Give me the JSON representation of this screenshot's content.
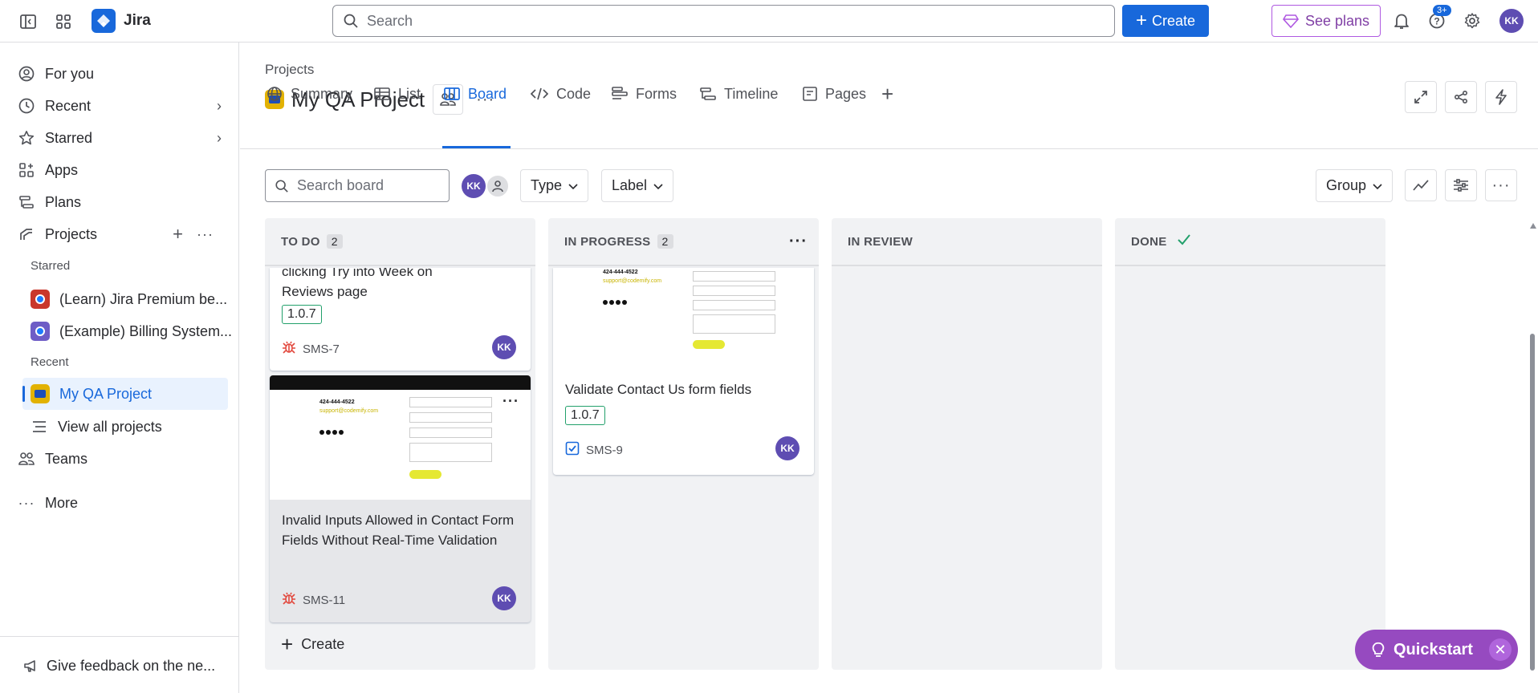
{
  "topbar": {
    "app_name": "Jira",
    "search_placeholder": "Search",
    "create_label": "Create",
    "see_plans_label": "See plans",
    "help_badge": "3+",
    "avatar_initials": "KK"
  },
  "sidebar": {
    "for_you": "For you",
    "recent": "Recent",
    "starred": "Starred",
    "apps": "Apps",
    "plans": "Plans",
    "projects": "Projects",
    "starred_section": "Starred",
    "starred_items": [
      "(Learn) Jira Premium be...",
      "(Example) Billing System..."
    ],
    "recent_section": "Recent",
    "recent_item": "My QA Project",
    "view_all": "View all projects",
    "teams": "Teams",
    "more": "More",
    "feedback": "Give feedback on the ne..."
  },
  "main": {
    "breadcrumb": "Projects",
    "project_title": "My QA Project",
    "tabs": [
      "Summary",
      "List",
      "Board",
      "Code",
      "Forms",
      "Timeline",
      "Pages"
    ],
    "search_board_placeholder": "Search board",
    "filter_avatar": "KK",
    "type_label": "Type",
    "label_label": "Label",
    "group_label": "Group"
  },
  "board": {
    "columns": [
      {
        "title": "TO DO",
        "count": "2"
      },
      {
        "title": "IN PROGRESS",
        "count": "2"
      },
      {
        "title": "IN REVIEW",
        "count": ""
      },
      {
        "title": "DONE",
        "count": ""
      }
    ],
    "todo_card1": {
      "title_partial_1": "clicking Try into Week on",
      "title_partial_2": "Reviews page",
      "version": "1.0.7",
      "key": "SMS-7",
      "assignee": "KK"
    },
    "todo_card2": {
      "title": "Invalid Inputs Allowed in Contact Form Fields Without Real-Time Validation",
      "key": "SMS-11",
      "assignee": "KK",
      "shot_phone": "424-444-4522",
      "shot_email": "support@codemify.com"
    },
    "inprog_card": {
      "title": "Validate Contact Us form fields",
      "version": "1.0.7",
      "key": "SMS-9",
      "assignee": "KK",
      "shot_phone": "424-444-4522",
      "shot_email": "support@codemify.com"
    },
    "create_label": "Create"
  },
  "quickstart": {
    "label": "Quickstart"
  }
}
